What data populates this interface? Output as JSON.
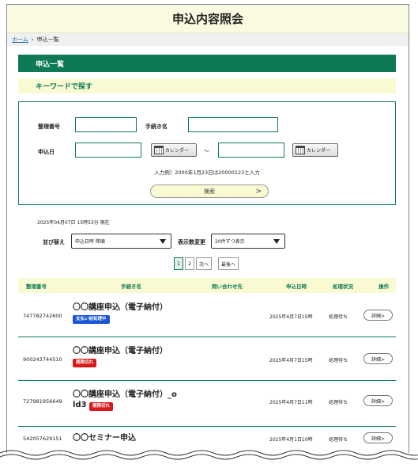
{
  "page_title": "申込内容照会",
  "breadcrumb": {
    "home": "ホーム",
    "separator": "›",
    "current": "申込一覧"
  },
  "section_title": "申込一覧",
  "keyword_title": "キーワードで探す",
  "search": {
    "ref_label": "整理番号",
    "proc_label": "手続き名",
    "date_label": "申込日",
    "calendar_label": "カレンダー",
    "tilde": "～",
    "hint": "入力例）2000年1月23日は20000123と入力",
    "search_button": "検索",
    "search_arrow": ">"
  },
  "timestamp": "2025年04月07日 15時53分 現在",
  "sort": {
    "label": "並び替え",
    "value": "申込日時 降順",
    "count_label": "表示数変更",
    "count_value": "20件ずつ表示"
  },
  "pager": {
    "page1": "1",
    "page2": "2",
    "next": "次へ",
    "last": "最後へ"
  },
  "table": {
    "headers": [
      "整理番号",
      "手続き名",
      "問い合わせ先",
      "申込日時",
      "処理状況",
      "操作"
    ],
    "rows": [
      {
        "id": "747782742600",
        "title": "〇〇講座申込（電子納付）",
        "title2": "",
        "badge": "支払い前処理中",
        "badge_color": "#1a55d6",
        "date": "2025年4月7日15時",
        "status": "処理待ち",
        "action": "詳細>"
      },
      {
        "id": "900243744510",
        "title": "〇〇講座申込（電子納付）",
        "title2": "",
        "badge": "期限切れ",
        "badge_color": "#d61a1a",
        "date": "2025年4月7日15時",
        "status": "処理待ち",
        "action": "詳細>"
      },
      {
        "id": "727981956649",
        "title": "〇〇講座申込（電子納付）_o",
        "title2": "ld3",
        "badge": "期限切れ",
        "badge_color": "#d61a1a",
        "date": "2025年4月7日11時",
        "status": "処理待ち",
        "action": "詳細>"
      },
      {
        "id": "542057629151",
        "title": "〇〇セミナー申込",
        "title2": "",
        "badge": "",
        "badge_color": "",
        "date": "2025年4月1日10時",
        "status": "処理待ち",
        "action": "詳細>"
      }
    ]
  },
  "colors": {
    "accent": "#0b7a55",
    "header_bg": "#fafae0",
    "highlight": "#fafad2"
  }
}
